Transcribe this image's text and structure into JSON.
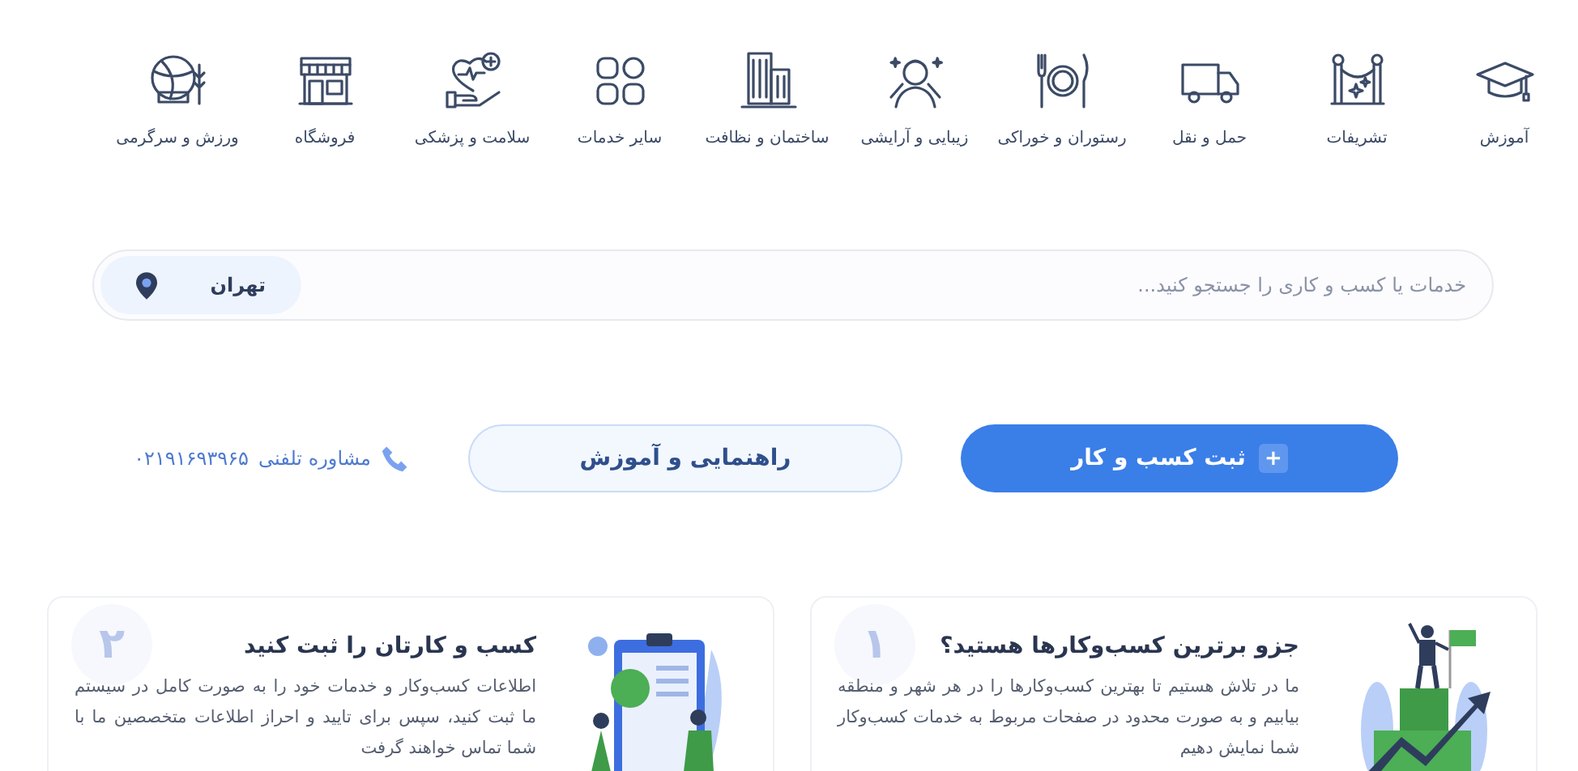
{
  "categories": [
    {
      "label": "آموزش"
    },
    {
      "label": "تشریفات"
    },
    {
      "label": "حمل و نقل"
    },
    {
      "label": "رستوران و خوراکی"
    },
    {
      "label": "زیبایی و آرایشی"
    },
    {
      "label": "ساختمان و نظافت"
    },
    {
      "label": "سایر خدمات"
    },
    {
      "label": "سلامت و پزشکی"
    },
    {
      "label": "فروشگاه"
    },
    {
      "label": "ورزش و سرگرمی"
    }
  ],
  "search": {
    "placeholder": "خدمات یا کسب و کاری را جستجو کنید...",
    "city": "تهران"
  },
  "actions": {
    "primary": {
      "icon": "+",
      "label": "ثبت کسب و کار"
    },
    "secondary": "راهنمایی و آموزش",
    "phone_label": "مشاوره تلفنی",
    "phone": "۰۲۱۹۱۶۹۳۹۶۵"
  },
  "cards": [
    {
      "number": "۱",
      "title": "جزو برترین کسب‌وکارها هستید؟",
      "text": "ما در تلاش هستیم تا بهترین کسب‌وکارها را در هر شهر و منطقه بیابیم و به صورت محدود در صفحات مربوط به خدمات کسب‌وکار شما نمایش دهیم"
    },
    {
      "number": "۲",
      "title": "کسب و کارتان را ثبت کنید",
      "text": "اطلاعات کسب‌وکار و خدمات خود را به صورت کامل در سیستم ما ثبت کنید، سپس برای تایید و احراز اطلاعات متخصصین ما با شما تماس خواهند گرفت"
    }
  ]
}
